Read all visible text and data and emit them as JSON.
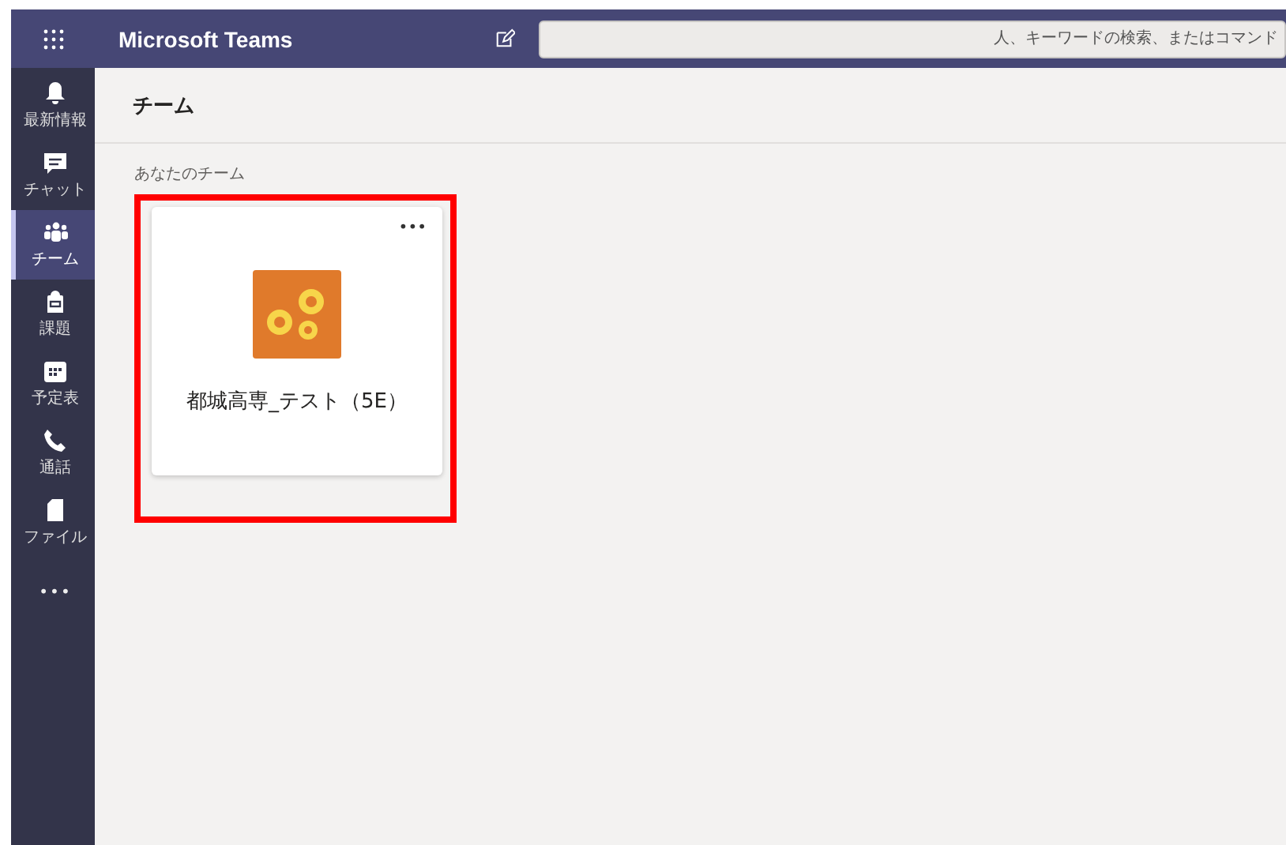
{
  "app": {
    "title": "Microsoft Teams"
  },
  "search": {
    "placeholder": "人、キーワードの検索、またはコマンド"
  },
  "sidebar": {
    "items": [
      {
        "kind": "bell",
        "label": "最新情報",
        "selected": false
      },
      {
        "kind": "chat",
        "label": "チャット",
        "selected": false
      },
      {
        "kind": "teams",
        "label": "チーム",
        "selected": true
      },
      {
        "kind": "bag",
        "label": "課題",
        "selected": false
      },
      {
        "kind": "calendar",
        "label": "予定表",
        "selected": false
      },
      {
        "kind": "phone",
        "label": "通話",
        "selected": false
      },
      {
        "kind": "file",
        "label": "ファイル",
        "selected": false
      },
      {
        "kind": "more",
        "label": "•••",
        "selected": false
      }
    ]
  },
  "page": {
    "heading": "チーム",
    "section_label": "あなたのチーム"
  },
  "teams": [
    {
      "name": "都城高専_テスト（5E）",
      "menu": "•••",
      "highlighted": true
    }
  ]
}
